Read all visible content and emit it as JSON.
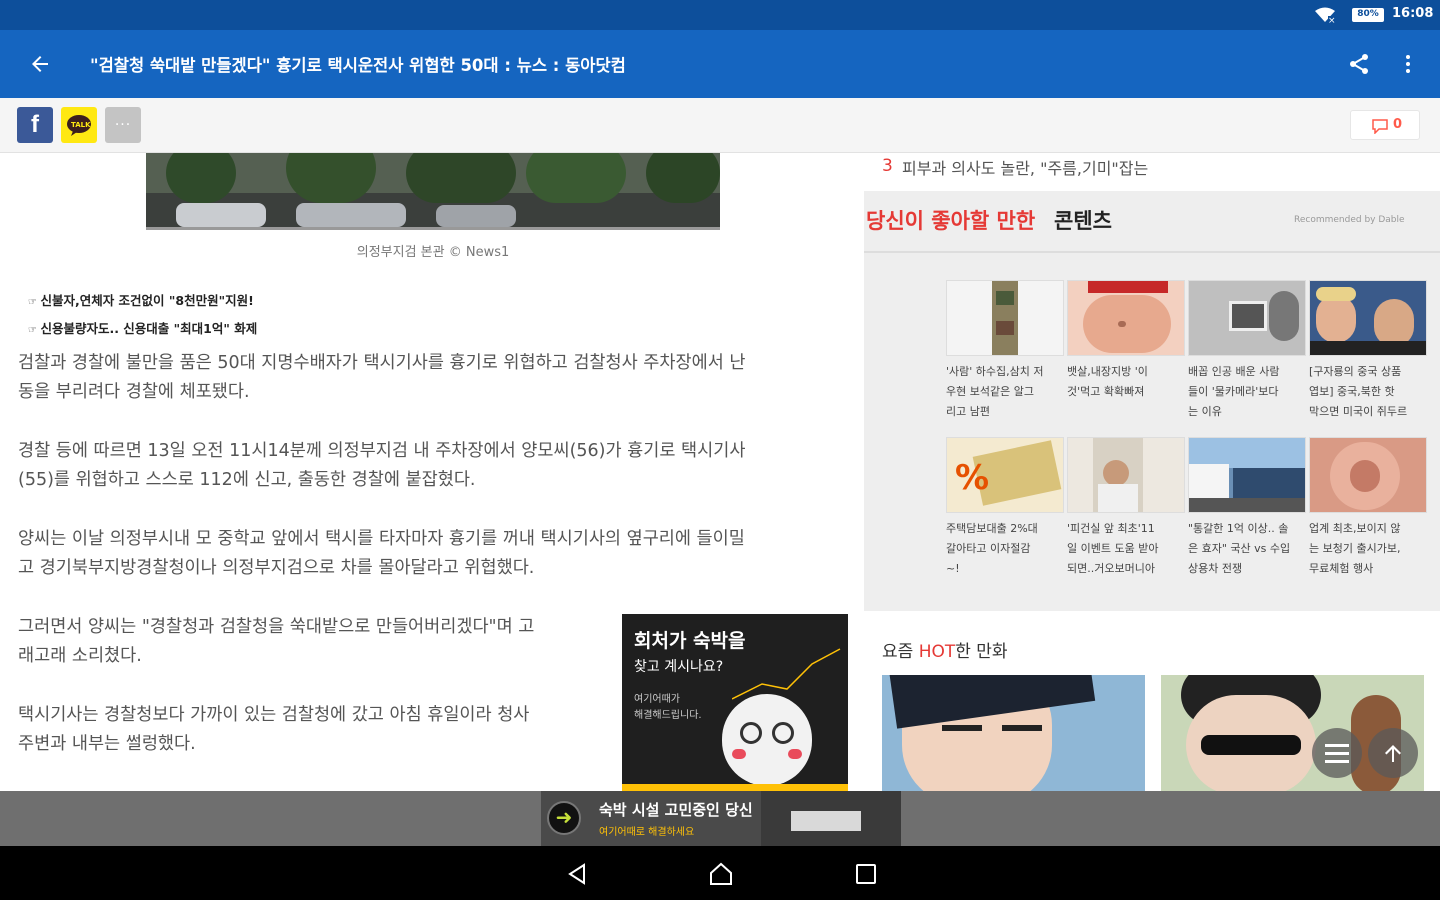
{
  "status_bar": {
    "battery": "80%",
    "time": "16:08"
  },
  "toolbar": {
    "title": "\"검찰청 쑥대밭 만들겠다\" 흉기로 택시운전사 위협한 50대 : 뉴스 : 동아닷컴"
  },
  "share_bar": {
    "comment_count": "0"
  },
  "article": {
    "photo_caption": "의정부지검 본관 © News1",
    "related": [
      "신불자,연체자 조건없이 \"8천만원\"지원!",
      "신용불량자도.. 신용대출 \"최대1억\" 화제"
    ],
    "paragraphs": [
      [
        "검찰과 경찰에 불만을 품은 50대 지명수배자가 택시기사를 흉기로 위협하고 검찰청사 주차장에서 난",
        "동을 부리려다 경찰에 체포됐다."
      ],
      [
        "경찰 등에 따르면 13일 오전 11시14분께 의정부지검 내 주차장에서 양모씨(56)가 흉기로 택시기사",
        "(55)를 위협하고 스스로 112에 신고, 출동한 경찰에 붙잡혔다."
      ],
      [
        "양씨는 이날 의정부시내 모 중학교 앞에서 택시를 타자마자 흉기를 꺼내 택시기사의 옆구리에 들이밀",
        "고 경기북부지방경찰청이나 의정부지검으로 차를 몰아달라고 위협했다."
      ],
      [
        "그러면서 양씨는 \"경찰청과 검찰청을 쑥대밭으로 만들어버리겠다\"며 고",
        "래고래 소리쳤다."
      ],
      [
        "택시기사는 경찰청보다 가까이 있는 검찰청에 갔고 아침 휴일이라 청사",
        "주변과 내부는 썰렁했다."
      ]
    ],
    "ad_box": {
      "headline": "회처가 숙박을",
      "headline2": "찾고 계시나요?",
      "sub1": "여기어때가",
      "sub2": "해결해드립니다."
    }
  },
  "sidebar": {
    "ranking_item": {
      "rank": "3",
      "text": "피부과 의사도 놀란, \"주름,기미\"잡는"
    },
    "recommend": {
      "title_red": "당신이 좋아할 만한",
      "title_black": "콘텐츠",
      "provider": "Recommended by Dable",
      "items": [
        {
          "lines": [
            "'사람' 하수집,삼치 저",
            "우현 보석같은 알그",
            "리고 남편"
          ]
        },
        {
          "lines": [
            "뱃살,내장지방 '이",
            "것'먹고 확확빠져"
          ]
        },
        {
          "lines": [
            "배꼽 인공 배운 사람",
            "들이 '물카메라'보다",
            "는 이유"
          ]
        },
        {
          "lines": [
            "[구자룡의 중국 상품",
            "엽보] 중국,북한 핫",
            "막으면 미국이 쥐두르"
          ]
        },
        {
          "lines": [
            "주택담보대출 2%대",
            "갈아타고 이자절감",
            "~!"
          ]
        },
        {
          "lines": [
            "'피건실 앞 최초'11",
            "일 이벤트 도움 받아",
            "되면..거오보머니아"
          ]
        },
        {
          "lines": [
            "\"통갈한 1억 이상.. 솔",
            "은 효자\" 국산 vs 수입",
            "상용차 전쟁"
          ]
        },
        {
          "lines": [
            "업계 최초,보이지 않",
            "는 보청기 출시가보,",
            "무료체험 행사"
          ]
        }
      ]
    },
    "hot_comics": {
      "prefix": "요즘 ",
      "hot": "HOT",
      "suffix": "한 만화"
    }
  },
  "bottom_ad": {
    "line1": "숙박 시설 고민중인 당신",
    "line2": "여기어때로 해결하세요"
  }
}
